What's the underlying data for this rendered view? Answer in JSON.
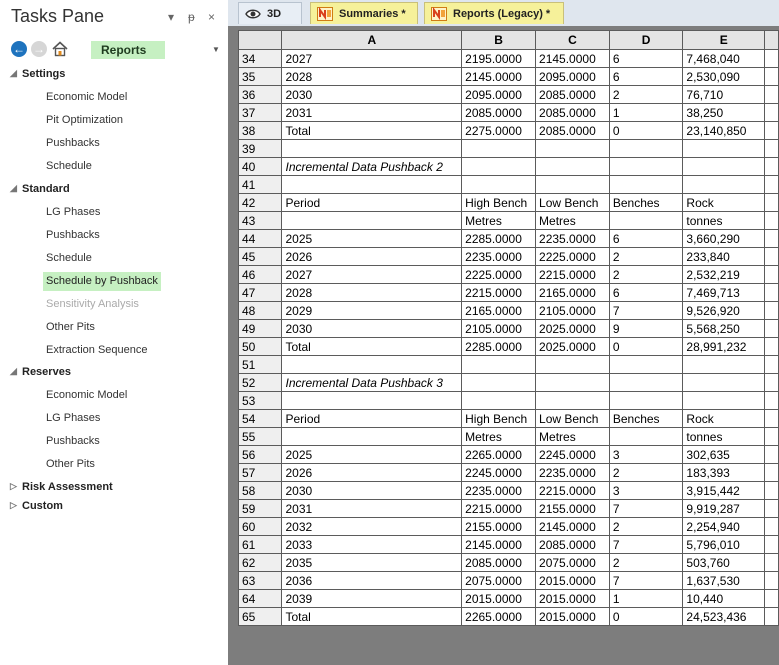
{
  "tasks_pane": {
    "title": "Tasks Pane",
    "dropdown_glyph": "▾",
    "pin_glyph": "ᵽ",
    "close_glyph": "×",
    "breadcrumb": "Reports",
    "categories": [
      {
        "label": "Settings",
        "expanded": true,
        "items": [
          {
            "label": "Economic Model"
          },
          {
            "label": "Pit Optimization"
          },
          {
            "label": "Pushbacks"
          },
          {
            "label": "Schedule"
          }
        ]
      },
      {
        "label": "Standard",
        "expanded": true,
        "items": [
          {
            "label": "LG Phases"
          },
          {
            "label": "Pushbacks"
          },
          {
            "label": "Schedule"
          },
          {
            "label": "Schedule by Pushback",
            "selected": true
          },
          {
            "label": "Sensitivity Analysis",
            "disabled": true
          },
          {
            "label": "Other Pits"
          },
          {
            "label": "Extraction Sequence"
          }
        ]
      },
      {
        "label": "Reserves",
        "expanded": true,
        "items": [
          {
            "label": "Economic Model"
          },
          {
            "label": "LG Phases"
          },
          {
            "label": "Pushbacks"
          },
          {
            "label": "Other Pits"
          }
        ]
      },
      {
        "label": "Risk Assessment",
        "expanded": false,
        "items": []
      },
      {
        "label": "Custom",
        "expanded": false,
        "items": []
      }
    ]
  },
  "tabs": [
    {
      "label": "3D",
      "icon": "eye-icon"
    },
    {
      "label": "Summaries *",
      "icon": "spreadsheet-icon"
    },
    {
      "label": "Reports (Legacy) *",
      "icon": "spreadsheet-icon",
      "active": true
    }
  ],
  "grid": {
    "columns": [
      "A",
      "B",
      "C",
      "D",
      "E"
    ],
    "rows": [
      {
        "n": "34",
        "cells": [
          "2027",
          "2195.0000",
          "2145.0000",
          "6",
          "7,468,040"
        ]
      },
      {
        "n": "35",
        "cells": [
          "2028",
          "2145.0000",
          "2095.0000",
          "6",
          "2,530,090"
        ]
      },
      {
        "n": "36",
        "cells": [
          "2030",
          "2095.0000",
          "2085.0000",
          "2",
          "76,710"
        ]
      },
      {
        "n": "37",
        "cells": [
          "2031",
          "2085.0000",
          "2085.0000",
          "1",
          "38,250"
        ]
      },
      {
        "n": "38",
        "cells": [
          "Total",
          "2275.0000",
          "2085.0000",
          "0",
          "23,140,850"
        ]
      },
      {
        "n": "39",
        "cells": [
          "",
          "",
          "",
          "",
          ""
        ]
      },
      {
        "n": "40",
        "cells": [
          "Incremental Data Pushback 2",
          "",
          "",
          "",
          ""
        ],
        "italic": true
      },
      {
        "n": "41",
        "cells": [
          "",
          "",
          "",
          "",
          ""
        ]
      },
      {
        "n": "42",
        "cells": [
          "Period",
          "High Bench",
          "Low Bench",
          "Benches",
          "Rock"
        ]
      },
      {
        "n": "43",
        "cells": [
          "",
          "Metres",
          "Metres",
          "",
          "tonnes"
        ]
      },
      {
        "n": "44",
        "cells": [
          "2025",
          "2285.0000",
          "2235.0000",
          "6",
          "3,660,290"
        ]
      },
      {
        "n": "45",
        "cells": [
          "2026",
          "2235.0000",
          "2225.0000",
          "2",
          "233,840"
        ]
      },
      {
        "n": "46",
        "cells": [
          "2027",
          "2225.0000",
          "2215.0000",
          "2",
          "2,532,219"
        ]
      },
      {
        "n": "47",
        "cells": [
          "2028",
          "2215.0000",
          "2165.0000",
          "6",
          "7,469,713"
        ]
      },
      {
        "n": "48",
        "cells": [
          "2029",
          "2165.0000",
          "2105.0000",
          "7",
          "9,526,920"
        ]
      },
      {
        "n": "49",
        "cells": [
          "2030",
          "2105.0000",
          "2025.0000",
          "9",
          "5,568,250"
        ]
      },
      {
        "n": "50",
        "cells": [
          "Total",
          "2285.0000",
          "2025.0000",
          "0",
          "28,991,232"
        ]
      },
      {
        "n": "51",
        "cells": [
          "",
          "",
          "",
          "",
          ""
        ]
      },
      {
        "n": "52",
        "cells": [
          "Incremental Data Pushback 3",
          "",
          "",
          "",
          ""
        ],
        "italic": true
      },
      {
        "n": "53",
        "cells": [
          "",
          "",
          "",
          "",
          ""
        ]
      },
      {
        "n": "54",
        "cells": [
          "Period",
          "High Bench",
          "Low Bench",
          "Benches",
          "Rock"
        ]
      },
      {
        "n": "55",
        "cells": [
          "",
          "Metres",
          "Metres",
          "",
          "tonnes"
        ]
      },
      {
        "n": "56",
        "cells": [
          "2025",
          "2265.0000",
          "2245.0000",
          "3",
          "302,635"
        ]
      },
      {
        "n": "57",
        "cells": [
          "2026",
          "2245.0000",
          "2235.0000",
          "2",
          "183,393"
        ]
      },
      {
        "n": "58",
        "cells": [
          "2030",
          "2235.0000",
          "2215.0000",
          "3",
          "3,915,442"
        ]
      },
      {
        "n": "59",
        "cells": [
          "2031",
          "2215.0000",
          "2155.0000",
          "7",
          "9,919,287"
        ]
      },
      {
        "n": "60",
        "cells": [
          "2032",
          "2155.0000",
          "2145.0000",
          "2",
          "2,254,940"
        ]
      },
      {
        "n": "61",
        "cells": [
          "2033",
          "2145.0000",
          "2085.0000",
          "7",
          "5,796,010"
        ]
      },
      {
        "n": "62",
        "cells": [
          "2035",
          "2085.0000",
          "2075.0000",
          "2",
          "503,760"
        ]
      },
      {
        "n": "63",
        "cells": [
          "2036",
          "2075.0000",
          "2015.0000",
          "7",
          "1,637,530"
        ]
      },
      {
        "n": "64",
        "cells": [
          "2039",
          "2015.0000",
          "2015.0000",
          "1",
          "10,440"
        ]
      },
      {
        "n": "65",
        "cells": [
          "Total",
          "2265.0000",
          "2015.0000",
          "0",
          "24,523,436"
        ]
      }
    ]
  }
}
